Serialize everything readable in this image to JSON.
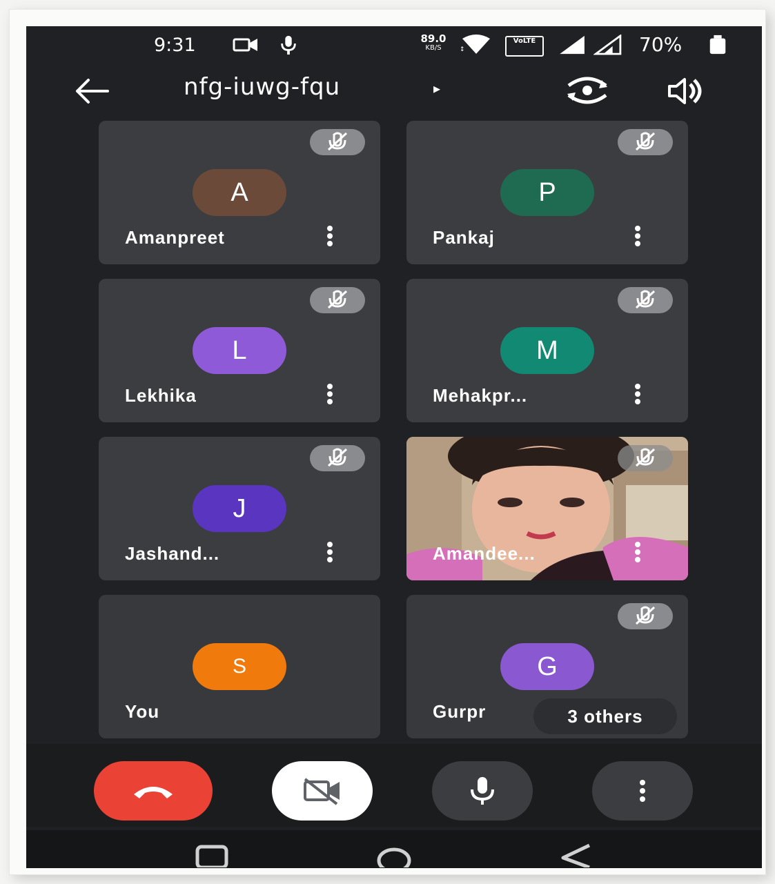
{
  "status_bar": {
    "time": "9:31",
    "net_speed_value": "89.0",
    "net_speed_unit": "KB/S",
    "volte_label": "VoLTE",
    "battery_percent": "70%"
  },
  "top_bar": {
    "meeting_code": "nfg-iuwg-fqu",
    "code_arrow": "▸"
  },
  "tiles": [
    {
      "initial": "A",
      "name": "Amanpreet",
      "color": "#6b4a3a"
    },
    {
      "initial": "P",
      "name": "Pankaj",
      "color": "#1f6b52"
    },
    {
      "initial": "L",
      "name": "Lekhika",
      "color": "#8f5ad8"
    },
    {
      "initial": "M",
      "name": "Mehakpr...",
      "color": "#128a73"
    },
    {
      "initial": "J",
      "name": "Jashand...",
      "color": "#5a35c0"
    },
    {
      "initial": "",
      "name": "Amandee...",
      "color": ""
    },
    {
      "initial": "S",
      "name": "You",
      "color": "#f07a0c"
    },
    {
      "initial": "G",
      "name": "Gurpr",
      "color": "#8a58d0"
    }
  ],
  "others_chip": "3 others",
  "colors": {
    "background": "#202124",
    "tile": "#3c3d40",
    "end_call": "#ea4335",
    "mute_badge": "#8a8b8e"
  },
  "icons": {
    "back": "back-arrow-icon",
    "switch_camera": "switch-camera-icon",
    "speaker": "speaker-icon",
    "end_call": "phone-hangup-icon",
    "camera_off": "video-off-icon",
    "mic": "mic-icon",
    "more": "more-vertical-icon"
  }
}
